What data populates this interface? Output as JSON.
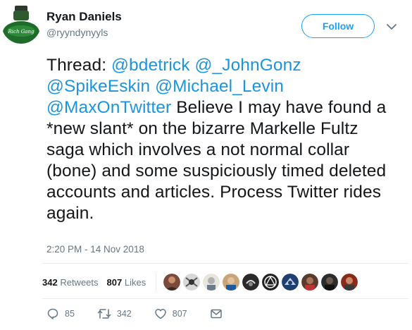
{
  "user": {
    "name": "Ryan Daniels",
    "handle": "@ryyndynyyls",
    "avatar_text": "Rich Gang"
  },
  "follow_label": "Follow",
  "tweet": {
    "prefix": "Thread: ",
    "mentions": [
      "@bdetrick",
      "@_JohnGonz",
      "@SpikeEskin",
      "@Michael_Levin",
      "@MaxOnTwitter"
    ],
    "body": "Believe I may have found a *new slant* on the bizarre Markelle Fultz saga which involves a not normal collar (bone) and some suspiciously timed deleted accounts and articles. Process Twitter rides again."
  },
  "timestamp": "2:20 PM - 14 Nov 2018",
  "stats": {
    "retweets_count": "342",
    "retweets_label": "Retweets",
    "likes_count": "807",
    "likes_label": "Likes"
  },
  "liker_avatars": [
    {
      "icon": "avatar-1"
    },
    {
      "icon": "avatar-2"
    },
    {
      "icon": "avatar-3"
    },
    {
      "icon": "avatar-4"
    },
    {
      "icon": "avatar-5"
    },
    {
      "icon": "avatar-6"
    },
    {
      "icon": "avatar-7"
    },
    {
      "icon": "avatar-8"
    },
    {
      "icon": "avatar-9"
    },
    {
      "icon": "avatar-10"
    }
  ],
  "actions": {
    "replies": "85",
    "retweets": "342",
    "likes": "807"
  },
  "colors": {
    "accent": "#1da1f2",
    "mention": "#1b95e0",
    "muted": "#657786",
    "text": "#14171a"
  }
}
